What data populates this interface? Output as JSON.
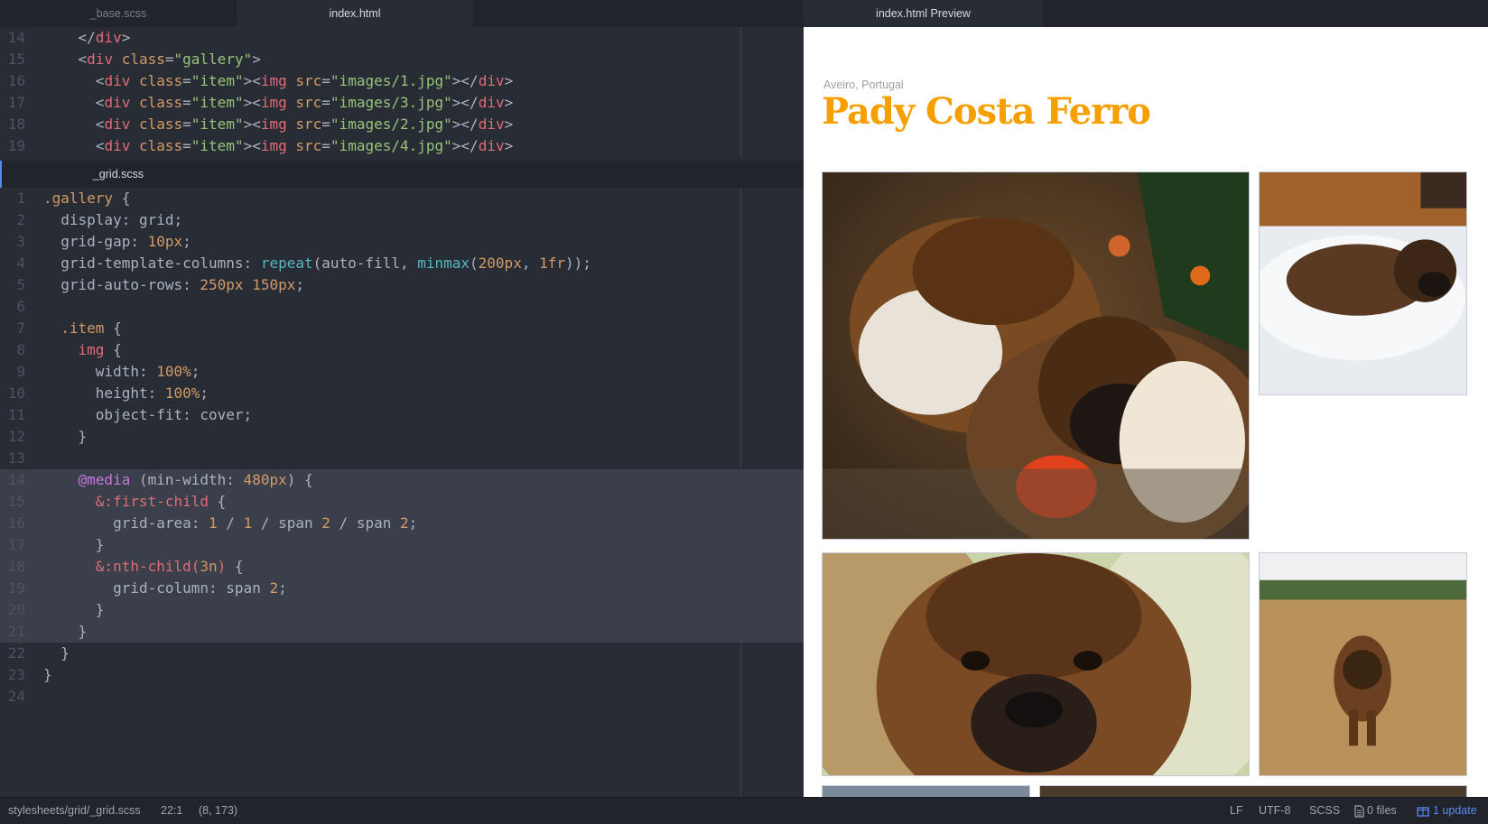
{
  "top_tabs": {
    "left": [
      "_base.scss",
      "index.html"
    ],
    "preview": "index.html Preview"
  },
  "top_pane": {
    "lines": [
      {
        "n": "14",
        "segs": [
          [
            "    ",
            "p"
          ],
          [
            "</",
            "p"
          ],
          [
            "div",
            "tag"
          ],
          [
            ">",
            "p"
          ]
        ]
      },
      {
        "n": "15",
        "segs": [
          [
            "    <",
            "p"
          ],
          [
            "div ",
            "tag"
          ],
          [
            "class",
            "attr"
          ],
          [
            "=",
            "p"
          ],
          [
            "\"gallery\"",
            "str"
          ],
          [
            ">",
            "p"
          ]
        ]
      },
      {
        "n": "16",
        "segs": [
          [
            "      <",
            "p"
          ],
          [
            "div ",
            "tag"
          ],
          [
            "class",
            "attr"
          ],
          [
            "=",
            "p"
          ],
          [
            "\"item\"",
            "str"
          ],
          [
            "><",
            "p"
          ],
          [
            "img ",
            "tag"
          ],
          [
            "src",
            "attr"
          ],
          [
            "=",
            "p"
          ],
          [
            "\"images/1.jpg\"",
            "str"
          ],
          [
            "></",
            "p"
          ],
          [
            "div",
            "tag"
          ],
          [
            ">",
            "p"
          ]
        ]
      },
      {
        "n": "17",
        "segs": [
          [
            "      <",
            "p"
          ],
          [
            "div ",
            "tag"
          ],
          [
            "class",
            "attr"
          ],
          [
            "=",
            "p"
          ],
          [
            "\"item\"",
            "str"
          ],
          [
            "><",
            "p"
          ],
          [
            "img ",
            "tag"
          ],
          [
            "src",
            "attr"
          ],
          [
            "=",
            "p"
          ],
          [
            "\"images/3.jpg\"",
            "str"
          ],
          [
            "></",
            "p"
          ],
          [
            "div",
            "tag"
          ],
          [
            ">",
            "p"
          ]
        ]
      },
      {
        "n": "18",
        "segs": [
          [
            "      <",
            "p"
          ],
          [
            "div ",
            "tag"
          ],
          [
            "class",
            "attr"
          ],
          [
            "=",
            "p"
          ],
          [
            "\"item\"",
            "str"
          ],
          [
            "><",
            "p"
          ],
          [
            "img ",
            "tag"
          ],
          [
            "src",
            "attr"
          ],
          [
            "=",
            "p"
          ],
          [
            "\"images/2.jpg\"",
            "str"
          ],
          [
            "></",
            "p"
          ],
          [
            "div",
            "tag"
          ],
          [
            ">",
            "p"
          ]
        ]
      },
      {
        "n": "19",
        "segs": [
          [
            "      <",
            "p"
          ],
          [
            "div ",
            "tag"
          ],
          [
            "class",
            "attr"
          ],
          [
            "=",
            "p"
          ],
          [
            "\"item\"",
            "str"
          ],
          [
            "><",
            "p"
          ],
          [
            "img ",
            "tag"
          ],
          [
            "src",
            "attr"
          ],
          [
            "=",
            "p"
          ],
          [
            "\"images/4.jpg\"",
            "str"
          ],
          [
            "></",
            "p"
          ],
          [
            "div",
            "tag"
          ],
          [
            ">",
            "p"
          ]
        ]
      }
    ]
  },
  "bottom_tab": "_grid.scss",
  "bottom_pane": {
    "lines": [
      {
        "n": "1",
        "segs": [
          [
            ".gallery",
            "sel"
          ],
          [
            " {",
            "p"
          ]
        ]
      },
      {
        "n": "2",
        "segs": [
          [
            "  display: grid;",
            "p"
          ]
        ]
      },
      {
        "n": "3",
        "segs": [
          [
            "  grid-gap: ",
            "p"
          ],
          [
            "10px",
            "num"
          ],
          [
            ";",
            "p"
          ]
        ]
      },
      {
        "n": "4",
        "segs": [
          [
            "  grid-template-columns: ",
            "p"
          ],
          [
            "repeat",
            "fn"
          ],
          [
            "(auto-fill, ",
            "p"
          ],
          [
            "minmax",
            "fn"
          ],
          [
            "(",
            "p"
          ],
          [
            "200px",
            "num"
          ],
          [
            ", ",
            "p"
          ],
          [
            "1fr",
            "num"
          ],
          [
            "));",
            "p"
          ]
        ]
      },
      {
        "n": "5",
        "segs": [
          [
            "  grid-auto-rows: ",
            "p"
          ],
          [
            "250px 150px",
            "num"
          ],
          [
            ";",
            "p"
          ]
        ]
      },
      {
        "n": "6",
        "segs": [
          [
            "",
            "p"
          ]
        ]
      },
      {
        "n": "7",
        "segs": [
          [
            "  ",
            "p"
          ],
          [
            ".item",
            "sel"
          ],
          [
            " {",
            "p"
          ]
        ]
      },
      {
        "n": "8",
        "segs": [
          [
            "    ",
            "p"
          ],
          [
            "img",
            "tag"
          ],
          [
            " {",
            "p"
          ]
        ]
      },
      {
        "n": "9",
        "segs": [
          [
            "      width: ",
            "p"
          ],
          [
            "100%",
            "num"
          ],
          [
            ";",
            "p"
          ]
        ]
      },
      {
        "n": "10",
        "segs": [
          [
            "      height: ",
            "p"
          ],
          [
            "100%",
            "num"
          ],
          [
            ";",
            "p"
          ]
        ]
      },
      {
        "n": "11",
        "segs": [
          [
            "      object-fit: cover;",
            "p"
          ]
        ]
      },
      {
        "n": "12",
        "segs": [
          [
            "    }",
            "p"
          ]
        ]
      },
      {
        "n": "13",
        "segs": [
          [
            "",
            "p"
          ]
        ]
      },
      {
        "n": "14",
        "sel": true,
        "segs": [
          [
            "    ",
            "p"
          ],
          [
            "@media",
            "kw"
          ],
          [
            " (min-width: ",
            "p"
          ],
          [
            "480px",
            "num"
          ],
          [
            ") {",
            "p"
          ]
        ]
      },
      {
        "n": "15",
        "sel": true,
        "segs": [
          [
            "      ",
            "p"
          ],
          [
            "&:first-child",
            "tag"
          ],
          [
            " {",
            "p"
          ]
        ]
      },
      {
        "n": "16",
        "sel": true,
        "segs": [
          [
            "        grid-area: ",
            "p"
          ],
          [
            "1",
            "num"
          ],
          [
            " / ",
            "p"
          ],
          [
            "1",
            "num"
          ],
          [
            " / span ",
            "p"
          ],
          [
            "2",
            "num"
          ],
          [
            " / span ",
            "p"
          ],
          [
            "2",
            "num"
          ],
          [
            ";",
            "p"
          ]
        ]
      },
      {
        "n": "17",
        "sel": true,
        "segs": [
          [
            "      }",
            "p"
          ]
        ]
      },
      {
        "n": "18",
        "sel": true,
        "segs": [
          [
            "      ",
            "p"
          ],
          [
            "&:nth-child(",
            "tag"
          ],
          [
            "3n",
            "num"
          ],
          [
            ")",
            "tag"
          ],
          [
            " {",
            "p"
          ]
        ]
      },
      {
        "n": "19",
        "sel": true,
        "segs": [
          [
            "        grid-column: span ",
            "p"
          ],
          [
            "2",
            "num"
          ],
          [
            ";",
            "p"
          ]
        ]
      },
      {
        "n": "20",
        "sel": true,
        "segs": [
          [
            "      }",
            "p"
          ]
        ]
      },
      {
        "n": "21",
        "sel": true,
        "segs": [
          [
            "    }",
            "p"
          ]
        ]
      },
      {
        "n": "22",
        "segs": [
          [
            "  }",
            "p"
          ]
        ]
      },
      {
        "n": "23",
        "segs": [
          [
            "}",
            "p"
          ]
        ]
      },
      {
        "n": "24",
        "segs": [
          [
            "",
            "p"
          ]
        ]
      }
    ]
  },
  "preview": {
    "subtitle": "Aveiro, Portugal",
    "title": "Pady Costa Ferro",
    "photos": [
      "images/1.jpg",
      "images/3.jpg",
      "images/2.jpg",
      "images/4.jpg"
    ]
  },
  "status": {
    "path": "stylesheets/grid/_grid.scss",
    "cursor": "22:1",
    "selection": "(8, 173)",
    "line_ending": "LF",
    "encoding": "UTF-8",
    "grammar": "SCSS",
    "files": "0 files",
    "update": "1 update"
  },
  "colors": {
    "accent": "#568af2",
    "title": "#f5a000"
  }
}
